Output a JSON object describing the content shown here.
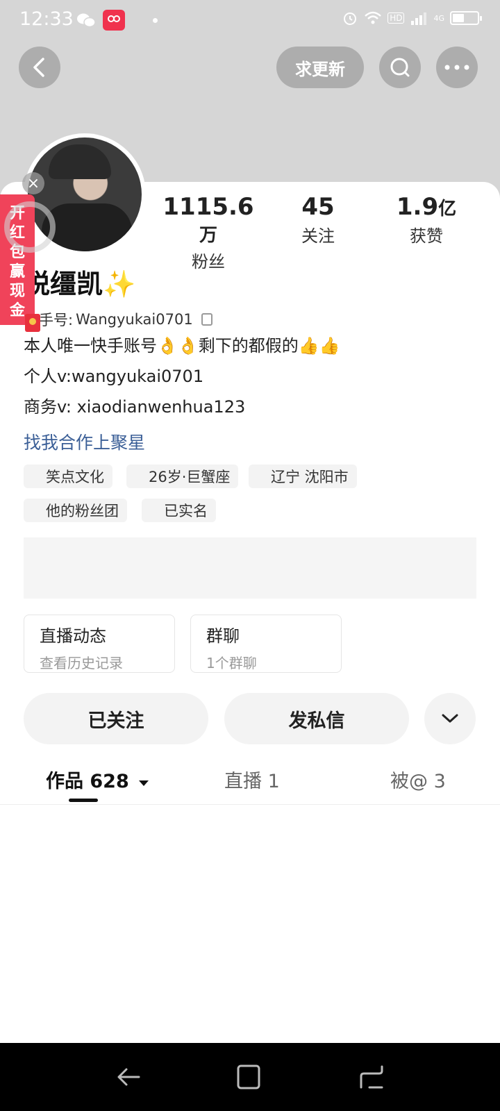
{
  "status": {
    "time": "12:33",
    "network": "4G",
    "hd": "HD"
  },
  "header": {
    "request_update_label": "求更新"
  },
  "stats": [
    {
      "value": "1115.6",
      "unit": "万",
      "label": "粉丝"
    },
    {
      "value": "45",
      "unit": "",
      "label": "关注"
    },
    {
      "value": "1.9",
      "unit": "亿",
      "label": "获赞"
    }
  ],
  "profile": {
    "name": "悦缰凯",
    "id_label": "手号:",
    "id_value": "Wangyukai0701",
    "bio": [
      "本人唯一快手账号👌👌剩下的都假的👍👍",
      "个人v:wangyukai0701",
      "商务v: xiaodianwenhua123"
    ],
    "cooperation_link": "找我合作上聚星",
    "tags": [
      "笑点文化",
      "26岁·巨蟹座",
      "辽宁 沈阳市",
      "他的粉丝团",
      "已实名"
    ]
  },
  "entries": [
    {
      "title": "直播动态",
      "subtitle": "查看历史记录"
    },
    {
      "title": "群聊",
      "subtitle": "1个群聊"
    }
  ],
  "actions": {
    "followed_label": "已关注",
    "message_label": "发私信"
  },
  "tabs": [
    {
      "label": "作品 628"
    },
    {
      "label": "直播 1"
    },
    {
      "label": "被@ 3"
    }
  ],
  "red_packet": {
    "chars": [
      "开",
      "红",
      "包",
      "赢",
      "现",
      "金"
    ]
  },
  "colors": {
    "red_packet": "#f0435a",
    "link": "#3b5f97",
    "header_bg": "#d6d6d6"
  }
}
